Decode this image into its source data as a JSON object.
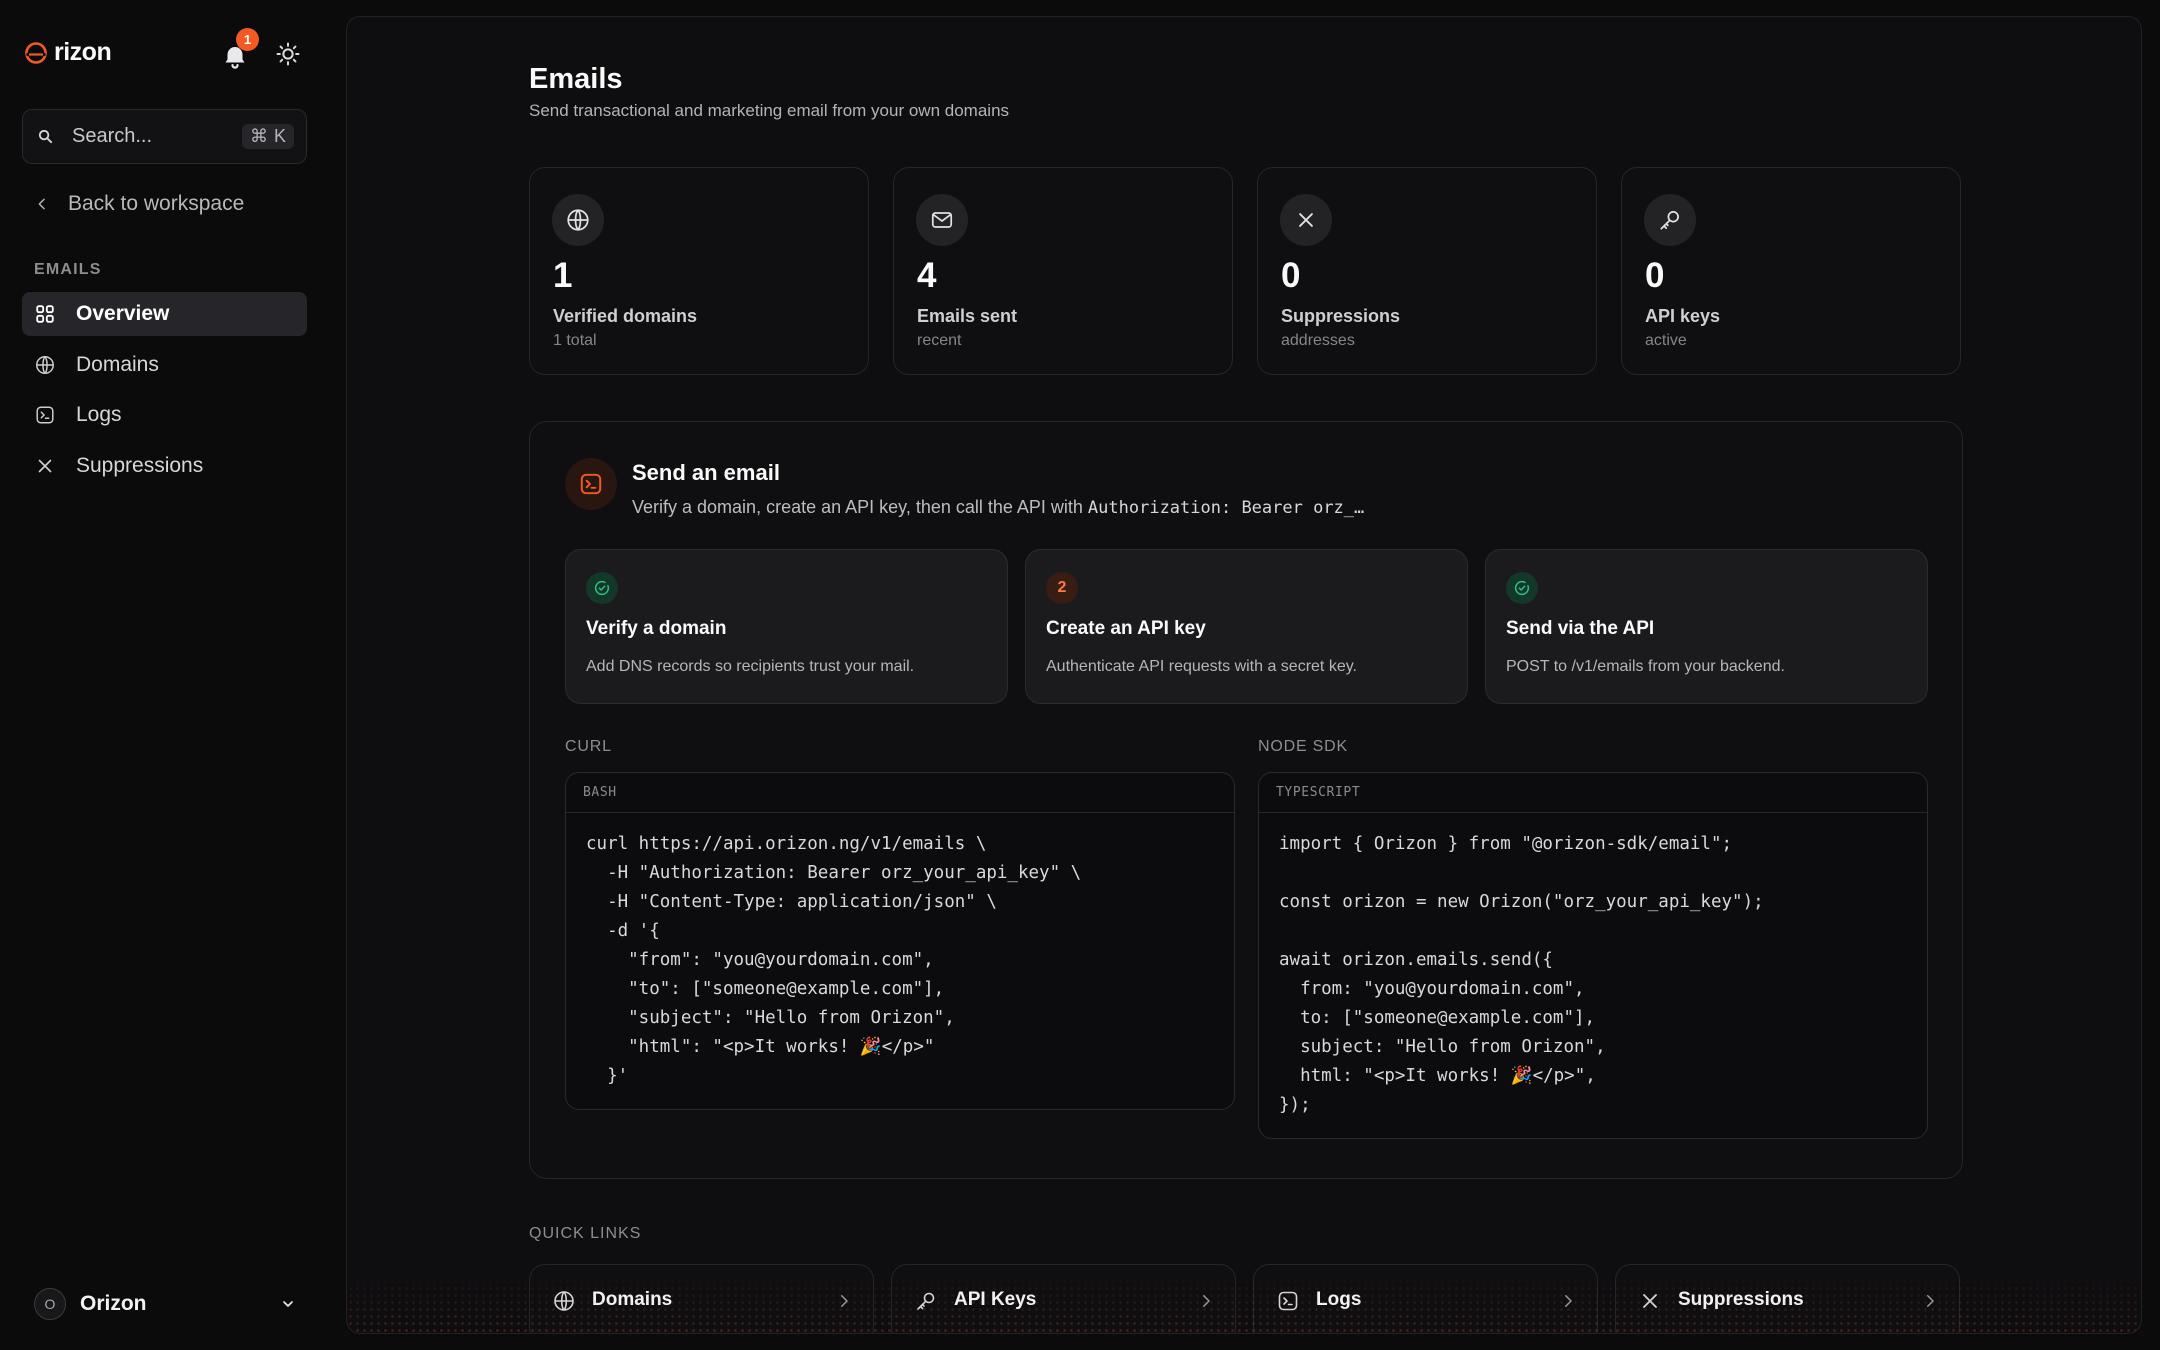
{
  "brand": {
    "name": "rizon",
    "accent": "#f15a24"
  },
  "header": {
    "notification_count": "1"
  },
  "search": {
    "placeholder": "Search...",
    "shortcut_symbol": "⌘",
    "shortcut_key": "K"
  },
  "sidebar": {
    "back_label": "Back to workspace",
    "section_label": "EMAILS",
    "items": [
      {
        "label": "Overview",
        "icon": "grid-icon",
        "active": true
      },
      {
        "label": "Domains",
        "icon": "globe-icon",
        "active": false
      },
      {
        "label": "Logs",
        "icon": "terminal-icon",
        "active": false
      },
      {
        "label": "Suppressions",
        "icon": "x-icon",
        "active": false
      }
    ],
    "org": {
      "initial": "O",
      "name": "Orizon"
    }
  },
  "page": {
    "title": "Emails",
    "subtitle": "Send transactional and marketing email from your own domains"
  },
  "stats": [
    {
      "value": "1",
      "label": "Verified domains",
      "sub": "1 total",
      "icon": "globe-icon"
    },
    {
      "value": "4",
      "label": "Emails sent",
      "sub": "recent",
      "icon": "mail-icon"
    },
    {
      "value": "0",
      "label": "Suppressions",
      "sub": "addresses",
      "icon": "x-icon"
    },
    {
      "value": "0",
      "label": "API keys",
      "sub": "active",
      "icon": "key-icon"
    }
  ],
  "send": {
    "title": "Send an email",
    "desc_prefix": "Verify a domain, create an API key, then call the API with ",
    "desc_code": "Authorization: Bearer orz_…",
    "steps": [
      {
        "badge": "",
        "status": "done",
        "title": "Verify a domain",
        "desc": "Add DNS records so recipients trust your mail."
      },
      {
        "badge": "2",
        "status": "pending",
        "title": "Create an API key",
        "desc": "Authenticate API requests with a secret key."
      },
      {
        "badge": "",
        "status": "done",
        "title": "Send via the API",
        "desc": "POST to /v1/emails from your backend."
      }
    ],
    "curl": {
      "label": "CURL",
      "lang": "BASH",
      "lines": [
        "curl https://api.orizon.ng/v1/emails \\",
        "  -H \"Authorization: Bearer orz_your_api_key\" \\",
        "  -H \"Content-Type: application/json\" \\",
        "  -d '{",
        "    \"from\": \"you@yourdomain.com\",",
        "    \"to\": [\"someone@example.com\"],",
        "    \"subject\": \"Hello from Orizon\",",
        "    \"html\": \"<p>It works! 🎉</p>\"",
        "  }'"
      ]
    },
    "node": {
      "label": "NODE SDK",
      "lang": "TYPESCRIPT",
      "lines": [
        "import { Orizon } from \"@orizon-sdk/email\";",
        "",
        "const orizon = new Orizon(\"orz_your_api_key\");",
        "",
        "await orizon.emails.send({",
        "  from: \"you@yourdomain.com\",",
        "  to: [\"someone@example.com\"],",
        "  subject: \"Hello from Orizon\",",
        "  html: \"<p>It works! 🎉</p>\",",
        "});"
      ]
    }
  },
  "quick_links": {
    "label": "QUICK LINKS",
    "items": [
      {
        "label": "Domains",
        "icon": "globe-icon"
      },
      {
        "label": "API Keys",
        "icon": "key-icon"
      },
      {
        "label": "Logs",
        "icon": "terminal-icon"
      },
      {
        "label": "Suppressions",
        "icon": "x-icon"
      }
    ]
  }
}
